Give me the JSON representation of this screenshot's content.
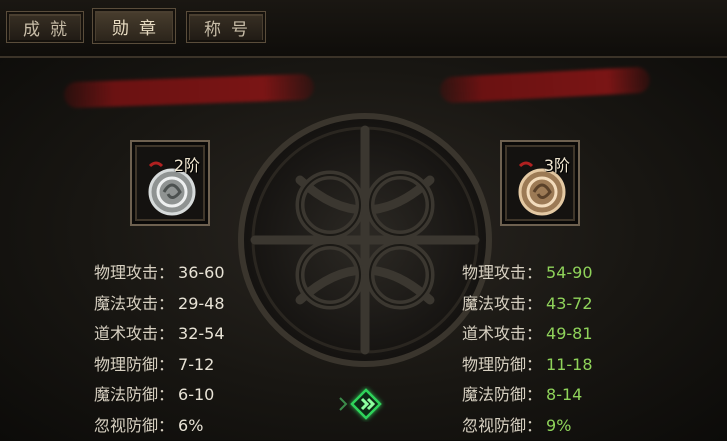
{
  "tabs": [
    {
      "label": "成就",
      "active": false
    },
    {
      "label": "勋章",
      "active": true
    },
    {
      "label": "称号",
      "active": false
    }
  ],
  "left_medal": {
    "tier": "2阶",
    "stats": [
      {
        "label": "物理攻击：",
        "value": "36-60"
      },
      {
        "label": "魔法攻击：",
        "value": "29-48"
      },
      {
        "label": "道术攻击：",
        "value": "32-54"
      },
      {
        "label": "物理防御：",
        "value": "7-12"
      },
      {
        "label": "魔法防御：",
        "value": "6-10"
      },
      {
        "label": "忽视防御：",
        "value": "6%"
      }
    ]
  },
  "right_medal": {
    "tier": "3阶",
    "stats": [
      {
        "label": "物理攻击：",
        "value": "54-90"
      },
      {
        "label": "魔法攻击：",
        "value": "43-72"
      },
      {
        "label": "道术攻击：",
        "value": "49-81"
      },
      {
        "label": "物理防御：",
        "value": "11-18"
      },
      {
        "label": "魔法防御：",
        "value": "8-14"
      },
      {
        "label": "忽视防御：",
        "value": "9%"
      }
    ]
  },
  "colors": {
    "upgrade_value": "#8fd35a",
    "base_value": "#e8e3d6",
    "label": "#d7d0c1",
    "arrow_glow": "#2fd25a"
  },
  "icons": {
    "left_medal": "silver-medal-icon",
    "right_medal": "bronze-medal-icon",
    "upgrade_arrow": "upgrade-arrow-icon"
  }
}
